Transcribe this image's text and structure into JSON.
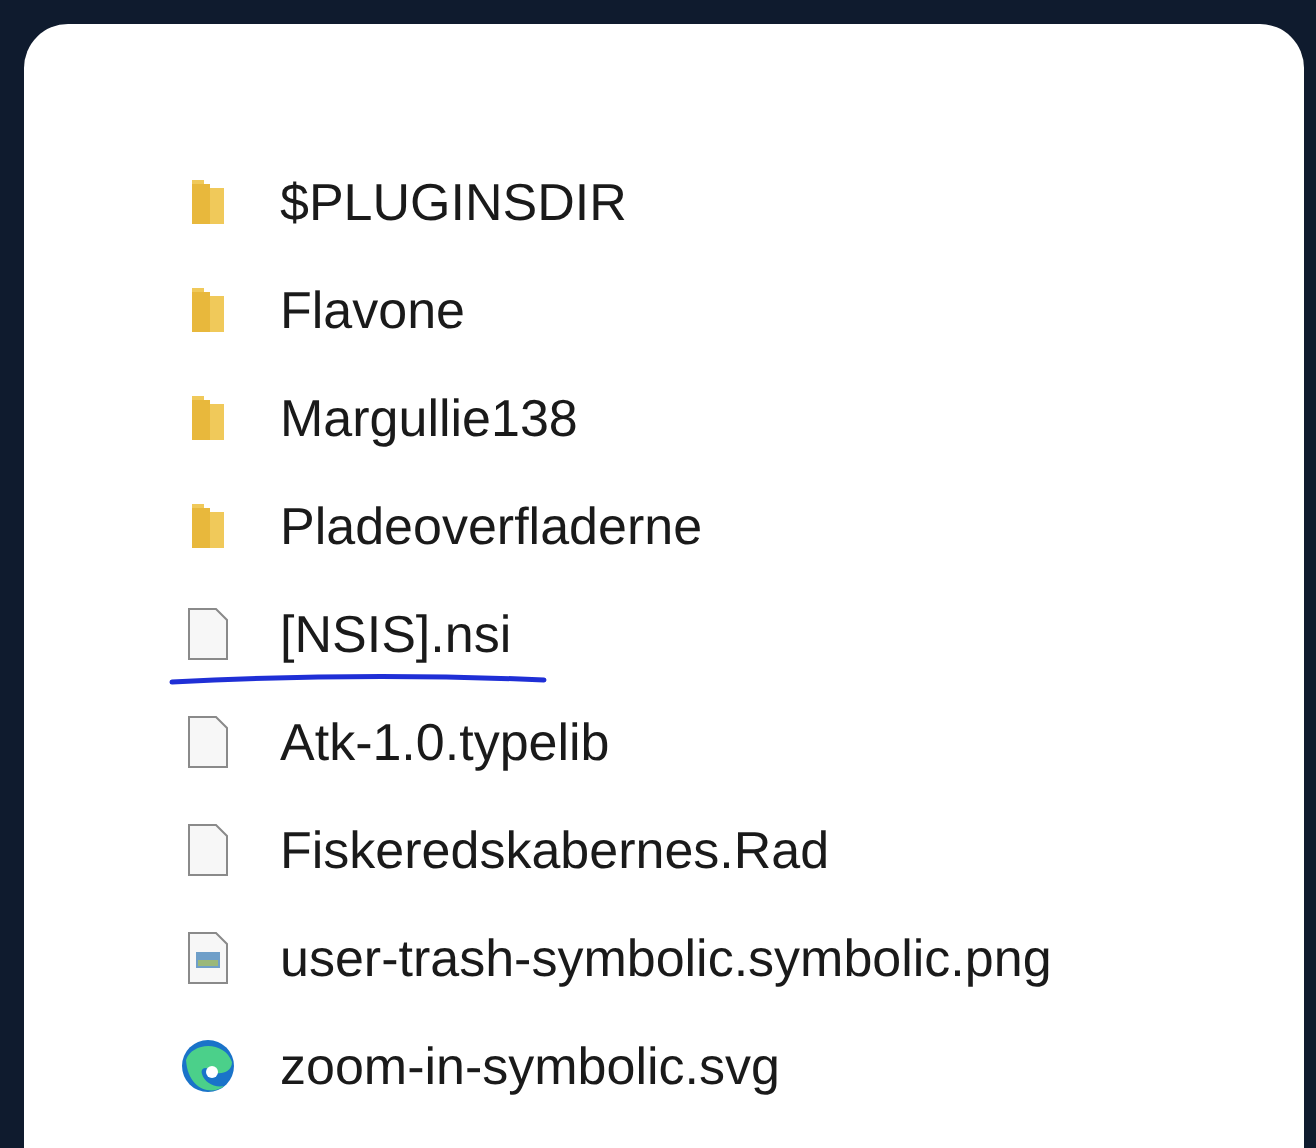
{
  "files": [
    {
      "name": "$PLUGINSDIR",
      "kind": "folder",
      "underlined": false
    },
    {
      "name": "Flavone",
      "kind": "folder",
      "underlined": false
    },
    {
      "name": "Margullie138",
      "kind": "folder",
      "underlined": false
    },
    {
      "name": "Pladeoverfladerne",
      "kind": "folder",
      "underlined": false
    },
    {
      "name": "[NSIS].nsi",
      "kind": "file",
      "underlined": true
    },
    {
      "name": "Atk-1.0.typelib",
      "kind": "file",
      "underlined": false
    },
    {
      "name": "Fiskeredskabernes.Rad",
      "kind": "file",
      "underlined": false
    },
    {
      "name": "user-trash-symbolic.symbolic.png",
      "kind": "image",
      "underlined": false
    },
    {
      "name": "zoom-in-symbolic.svg",
      "kind": "browser",
      "underlined": false
    }
  ]
}
